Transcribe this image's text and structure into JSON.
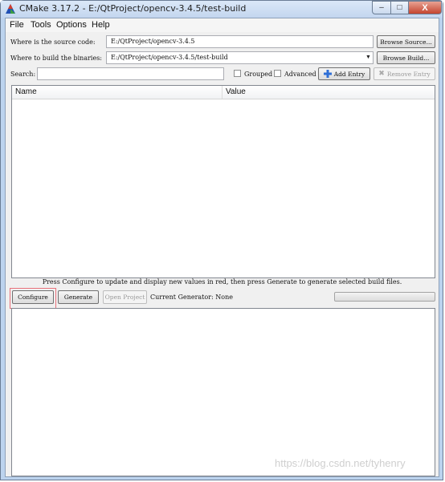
{
  "window": {
    "title": "CMake 3.17.2 - E:/QtProject/opencv-3.4.5/test-build",
    "min_glyph": "–",
    "max_glyph": "□",
    "close_glyph": "X"
  },
  "menu": [
    "File",
    "Tools",
    "Options",
    "Help"
  ],
  "source": {
    "label": "Where is the source code:",
    "value": "E:/QtProject/opencv-3.4.5",
    "button": "Browse Source..."
  },
  "build": {
    "label": "Where to build the binaries:",
    "value": "E:/QtProject/opencv-3.4.5/test-build",
    "button": "Browse Build..."
  },
  "search": {
    "label": "Search:",
    "value": "",
    "grouped": "Grouped",
    "advanced": "Advanced",
    "add_entry": "Add Entry",
    "remove_entry": "Remove Entry"
  },
  "table": {
    "columns": [
      "Name",
      "Value"
    ]
  },
  "hint": "Press Configure to update and display new values in red, then press Generate to generate selected build files.",
  "actions": {
    "configure": "Configure",
    "generate": "Generate",
    "open_project": "Open Project",
    "generator_label": "Current Generator: None"
  },
  "watermark": "https://blog.csdn.net/tyhenry",
  "colors": {
    "highlight_border": "#e8707a",
    "add_icon": "#2f6fd6"
  }
}
